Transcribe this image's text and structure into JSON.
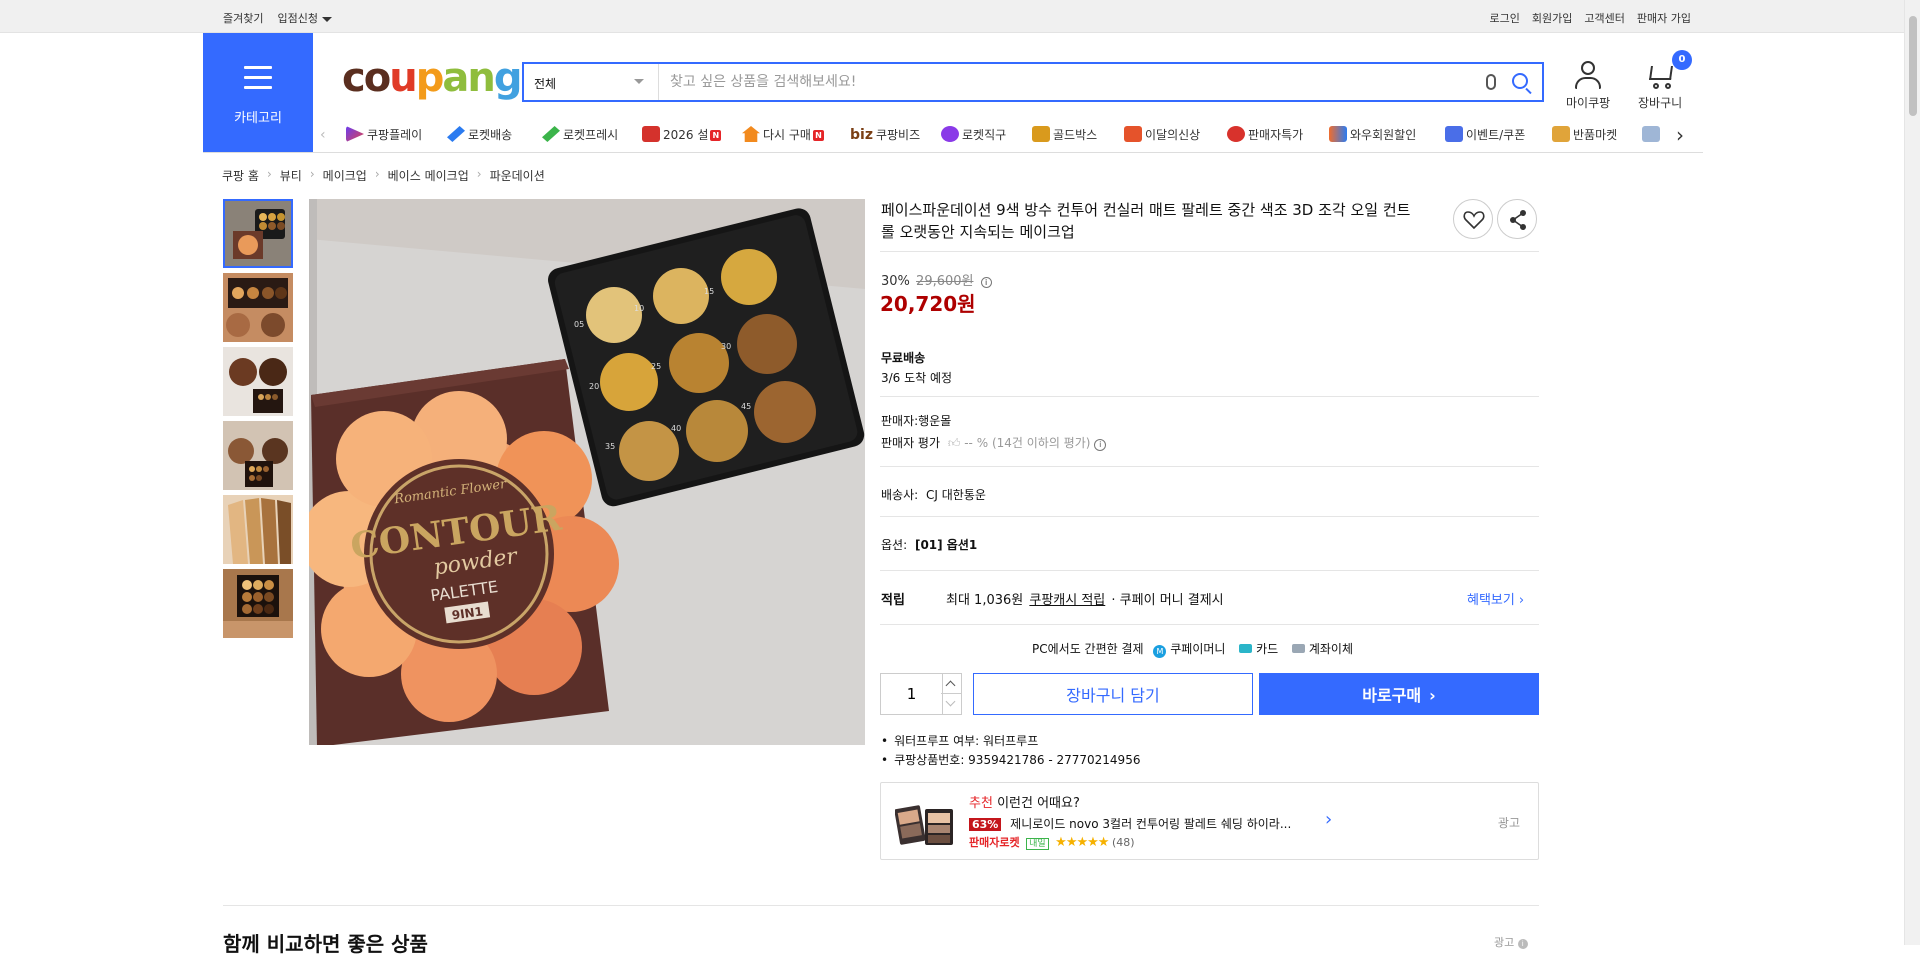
{
  "topbar": {
    "bookmark": "즐겨찾기",
    "seller_apply": "입점신청",
    "login": "로그인",
    "signup": "회원가입",
    "customer_center": "고객센터",
    "seller_signup": "판매자 가입"
  },
  "header": {
    "category_label": "카테고리",
    "logo": "coupang",
    "search_category": "전체",
    "search_placeholder": "찾고 싶은 상품을 검색해보세요!",
    "mypage_label": "마이쿠팡",
    "cart_label": "장바구니",
    "cart_count": "0"
  },
  "nav": {
    "items": [
      "쿠팡플레이",
      "로켓배송",
      "로켓프레시",
      "2026 설",
      "다시 구매",
      "쿠팡비즈",
      "로켓직구",
      "골드박스",
      "이달의신상",
      "판매자특가",
      "와우회원할인",
      "이벤트/쿠폰",
      "반품마켓"
    ],
    "biz_prefix": "biz",
    "new_badge": "N"
  },
  "breadcrumb": [
    "쿠팡 홈",
    "뷰티",
    "메이크업",
    "베이스 메이크업",
    "파운데이션"
  ],
  "product": {
    "title": "페이스파운데이션 9색 방수 컨투어 컨실러 매트 팔레트 중간 색조 3D 조각 오일 컨트롤 오랫동안 지속되는 메이크업",
    "discount_rate": "30%",
    "original_price": "29,600원",
    "price": "20,720원",
    "shipping_title": "무료배송",
    "arrival": "3/6 도착 예정",
    "seller_label": "판매자:",
    "seller_name": "행운몰",
    "seller_rating_label": "판매자 평가",
    "seller_rating_value": "-- %",
    "seller_rating_note": "(14건 이하의 평가)",
    "carrier_label": "배송사:",
    "carrier_name": "CJ 대한통운",
    "option_label": "옵션:",
    "option_value": "[01] 옵션1",
    "cashback_label": "적립",
    "cashback_prefix": "최대 1,036원",
    "cashback_link": "쿠팡캐시 적립",
    "cashback_suffix": "· 쿠페이 머니 결제시",
    "benefit_link": "혜택보기",
    "pay_title": "PC에서도 간편한 결제",
    "pay_methods": [
      "쿠페이머니",
      "카드",
      "계좌이체"
    ],
    "quantity": "1",
    "add_to_cart": "장바구니 담기",
    "buy_now": "바로구매",
    "attrs": [
      "워터프루프 여부: 워터프루프",
      "쿠팡상품번호: 9359421786 - 27770214956"
    ],
    "image_text": {
      "brand": "Romantic Flower",
      "line1": "CONTOUR",
      "line2": "powder",
      "line3": "PALETTE",
      "badge": "9IN1",
      "shade_numbers": [
        "05",
        "10",
        "15",
        "20",
        "25",
        "30",
        "35",
        "40",
        "45"
      ]
    }
  },
  "recommend": {
    "tag": "추천",
    "title": "이런건 어때요?",
    "discount": "63%",
    "name": "제니로이드 novo 3컬러 컨투어링 팔레트 쉐딩 하이라...",
    "badge": "판매자로켓",
    "badge2": "내일",
    "stars": "★★★★★",
    "reviews": "(48)",
    "ad": "광고"
  },
  "bottom": {
    "section_title": "함께 비교하면 좋은 상품",
    "ad": "광고"
  },
  "colors": {
    "brand_blue": "#346aff",
    "price_red": "#ae0000"
  }
}
